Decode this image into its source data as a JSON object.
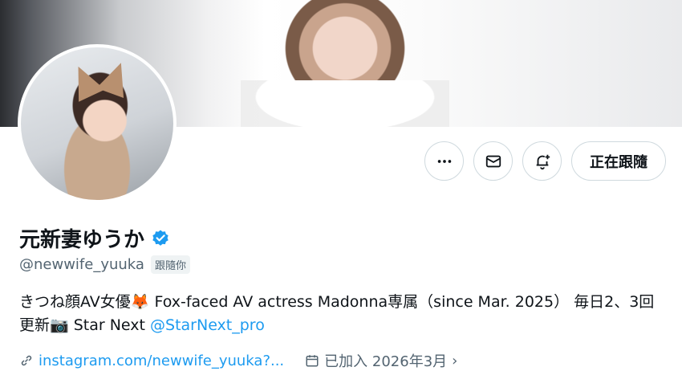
{
  "profile": {
    "display_name": "元新妻ゆうか",
    "handle": "@newwife_yuuka",
    "follows_you": "跟隨你",
    "follow_label": "正在跟隨",
    "bio_text": "きつね顔AV女優🦊 Fox-faced AV actress Madonna専属（since Mar. 2025） 毎日2、3回更新📷 Star Next ",
    "bio_link": "@StarNext_pro",
    "website": "instagram.com/newwife_yuuka?...",
    "joined": "已加入 2026年3月"
  },
  "icons": {
    "more": "more-horizontal-icon",
    "message": "mail-icon",
    "notify": "bell-plus-icon",
    "verified": "verified-badge-icon",
    "link": "link-icon",
    "calendar": "calendar-icon"
  },
  "colors": {
    "accent": "#1d9bf0",
    "text": "#0f1419",
    "muted": "#536471",
    "border": "#cfd9de"
  }
}
